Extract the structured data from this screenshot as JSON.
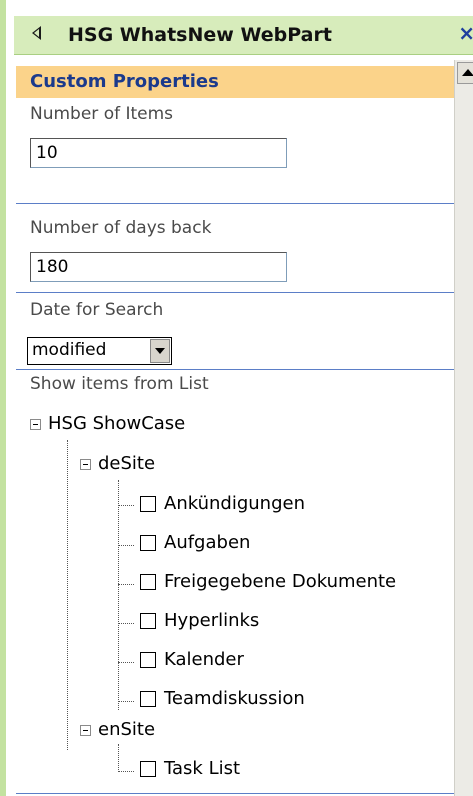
{
  "panel": {
    "title": "HSG WhatsNew WebPart",
    "close_label": "×"
  },
  "section": {
    "header": "Custom Properties"
  },
  "fields": {
    "items_label": "Number of Items",
    "items_value": "10",
    "days_label": "Number of days back",
    "days_value": "180",
    "date_label": "Date for Search",
    "date_value": "modified",
    "list_label": "Show items from List"
  },
  "tree": {
    "root": "HSG ShowCase",
    "de_site": {
      "label": "deSite",
      "lists": [
        "Ankündigungen",
        "Aufgaben",
        "Freigegebene Dokumente",
        "Hyperlinks",
        "Kalender",
        "Teamdiskussion"
      ]
    },
    "en_site": {
      "label": "enSite",
      "lists": [
        "Task List"
      ]
    }
  },
  "colors": {
    "titlebar": "#d7ecbb",
    "section_header_bg": "#fbd38a",
    "section_header_text": "#1b3a8c",
    "divider": "#5b7ec7"
  },
  "icons": {
    "collapse": "back-arrow-icon",
    "close": "close-icon",
    "scroll_up": "scroll-up-arrow-icon",
    "dropdown": "chevron-down-icon",
    "tree_expander": "minus-box-icon"
  }
}
